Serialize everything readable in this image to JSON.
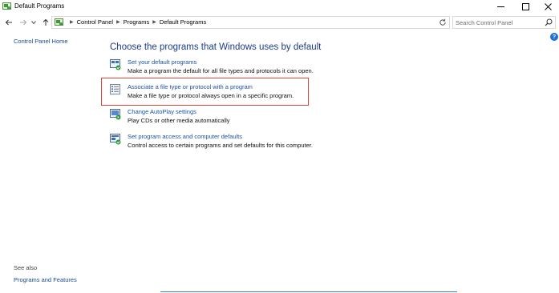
{
  "window": {
    "title": "Default Programs",
    "minimize_icon": "minimize-icon",
    "maximize_icon": "maximize-icon",
    "close_icon": "close-icon"
  },
  "address_bar": {
    "breadcrumbs": [
      "Control Panel",
      "Programs",
      "Default Programs"
    ],
    "search_placeholder": "Search Control Panel"
  },
  "sidebar": {
    "home_label": "Control Panel Home",
    "see_also_label": "See also",
    "see_also_items": [
      "Programs and Features"
    ]
  },
  "main": {
    "title": "Choose the programs that Windows uses by default",
    "tasks": [
      {
        "label": "Set your default programs",
        "description": "Make a program the default for all file types and protocols it can open.",
        "icon": "default-programs-icon"
      },
      {
        "label": "Associate a file type or protocol with a program",
        "description": "Make a file type or protocol always open in a specific program.",
        "icon": "file-association-icon"
      },
      {
        "label": "Change AutoPlay settings",
        "description": "Play CDs or other media automatically",
        "icon": "autoplay-icon"
      },
      {
        "label": "Set program access and computer defaults",
        "description": "Control access to certain programs and set defaults for this computer.",
        "icon": "program-access-icon"
      }
    ]
  },
  "help": {
    "label": "?"
  },
  "colors": {
    "link": "#1a52a8",
    "title": "#1e3a8a",
    "highlight": "#e0443f"
  }
}
